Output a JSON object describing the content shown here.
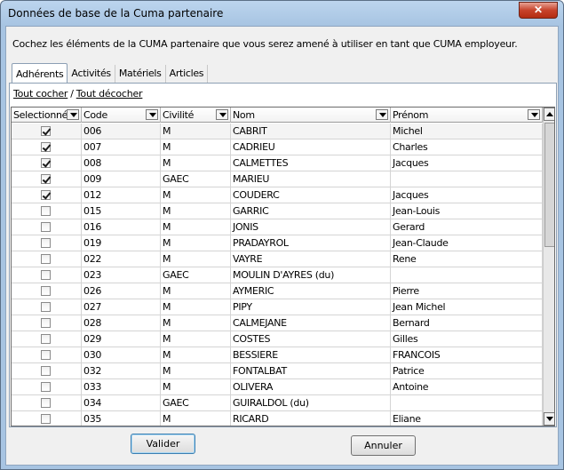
{
  "window": {
    "title": "Données de base de la Cuma partenaire",
    "close_glyph": "✕"
  },
  "instruction": "Cochez les éléments de la CUMA partenaire que vous serez amené à utiliser en tant que CUMA employeur.",
  "tabs": [
    {
      "label": "Adhérents",
      "active": true
    },
    {
      "label": "Activités",
      "active": false
    },
    {
      "label": "Matériels",
      "active": false
    },
    {
      "label": "Articles",
      "active": false
    }
  ],
  "links": {
    "check_all": "Tout cocher",
    "separator": "/",
    "uncheck_all": "Tout décocher"
  },
  "grid": {
    "columns": [
      "Selectionné",
      "Code",
      "Civilité",
      "Nom",
      "Prénom"
    ],
    "rows": [
      {
        "selected": true,
        "code": "006",
        "civilite": "M",
        "nom": "CABRIT",
        "prenom": "Michel"
      },
      {
        "selected": true,
        "code": "007",
        "civilite": "M",
        "nom": "CADRIEU",
        "prenom": "Charles"
      },
      {
        "selected": true,
        "code": "008",
        "civilite": "M",
        "nom": "CALMETTES",
        "prenom": "Jacques"
      },
      {
        "selected": true,
        "code": "009",
        "civilite": "GAEC",
        "nom": "MARIEU",
        "prenom": ""
      },
      {
        "selected": true,
        "code": "012",
        "civilite": "M",
        "nom": "COUDERC",
        "prenom": "Jacques"
      },
      {
        "selected": false,
        "code": "015",
        "civilite": "M",
        "nom": "GARRIC",
        "prenom": "Jean-Louis"
      },
      {
        "selected": false,
        "code": "016",
        "civilite": "M",
        "nom": "JONIS",
        "prenom": "Gerard"
      },
      {
        "selected": false,
        "code": "019",
        "civilite": "M",
        "nom": "PRADAYROL",
        "prenom": "Jean-Claude"
      },
      {
        "selected": false,
        "code": "022",
        "civilite": "M",
        "nom": "VAYRE",
        "prenom": "Rene"
      },
      {
        "selected": false,
        "code": "023",
        "civilite": "GAEC",
        "nom": "MOULIN D'AYRES (du)",
        "prenom": ""
      },
      {
        "selected": false,
        "code": "026",
        "civilite": "M",
        "nom": "AYMERIC",
        "prenom": "Pierre"
      },
      {
        "selected": false,
        "code": "027",
        "civilite": "M",
        "nom": "PIPY",
        "prenom": "Jean Michel"
      },
      {
        "selected": false,
        "code": "028",
        "civilite": "M",
        "nom": "CALMEJANE",
        "prenom": "Bernard"
      },
      {
        "selected": false,
        "code": "029",
        "civilite": "M",
        "nom": "COSTES",
        "prenom": "Gilles"
      },
      {
        "selected": false,
        "code": "030",
        "civilite": "M",
        "nom": "BESSIERE",
        "prenom": "FRANCOIS"
      },
      {
        "selected": false,
        "code": "032",
        "civilite": "M",
        "nom": "FONTALBAT",
        "prenom": "Patrice"
      },
      {
        "selected": false,
        "code": "033",
        "civilite": "M",
        "nom": "OLIVERA",
        "prenom": "Antoine"
      },
      {
        "selected": false,
        "code": "034",
        "civilite": "GAEC",
        "nom": "GUIRALDOL (du)",
        "prenom": ""
      },
      {
        "selected": false,
        "code": "035",
        "civilite": "M",
        "nom": "RICARD",
        "prenom": "Eliane"
      }
    ]
  },
  "buttons": {
    "ok": "Valider",
    "cancel": "Annuler"
  }
}
